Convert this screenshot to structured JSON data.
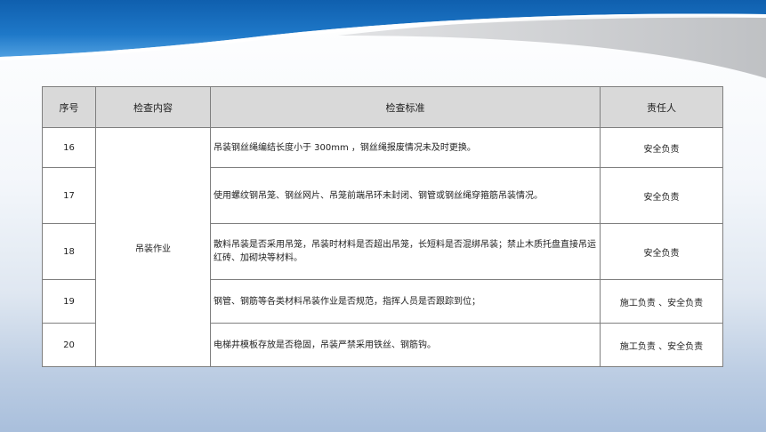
{
  "colors": {
    "banner_blue": "#1e73be",
    "banner_light": "#5aa7e2",
    "banner_gray": "#c7c8ca",
    "header_bg": "#d9d9d9",
    "border": "#7f7f7f"
  },
  "table": {
    "headers": {
      "index": "序号",
      "content": "检查内容",
      "standard": "检查标准",
      "owner": "责任人"
    },
    "category": "吊装作业",
    "rows": [
      {
        "index": "16",
        "standard": "吊装钢丝绳编结长度小于 300mm ，钢丝绳报废情况未及时更换。",
        "owner": "安全负责"
      },
      {
        "index": "17",
        "standard": "使用螺纹钢吊笼、钢丝网片、吊笼前端吊环未封闭、钢管或钢丝绳穿箍筋吊装情况。",
        "owner": "安全负责"
      },
      {
        "index": "18",
        "standard": "散料吊装是否采用吊笼，吊装时材料是否超出吊笼，长短料是否混绑吊装；禁止木质托盘直接吊运红砖、加砌块等材料。",
        "owner": "安全负责"
      },
      {
        "index": "19",
        "standard": "钢管、钢筋等各类材料吊装作业是否规范，指挥人员是否跟踪到位；",
        "owner": "施工负责 、安全负责"
      },
      {
        "index": "20",
        "standard": "电梯井模板存放是否稳固，吊装严禁采用铁丝、钢筋钩。",
        "owner": "施工负责 、安全负责"
      }
    ]
  }
}
